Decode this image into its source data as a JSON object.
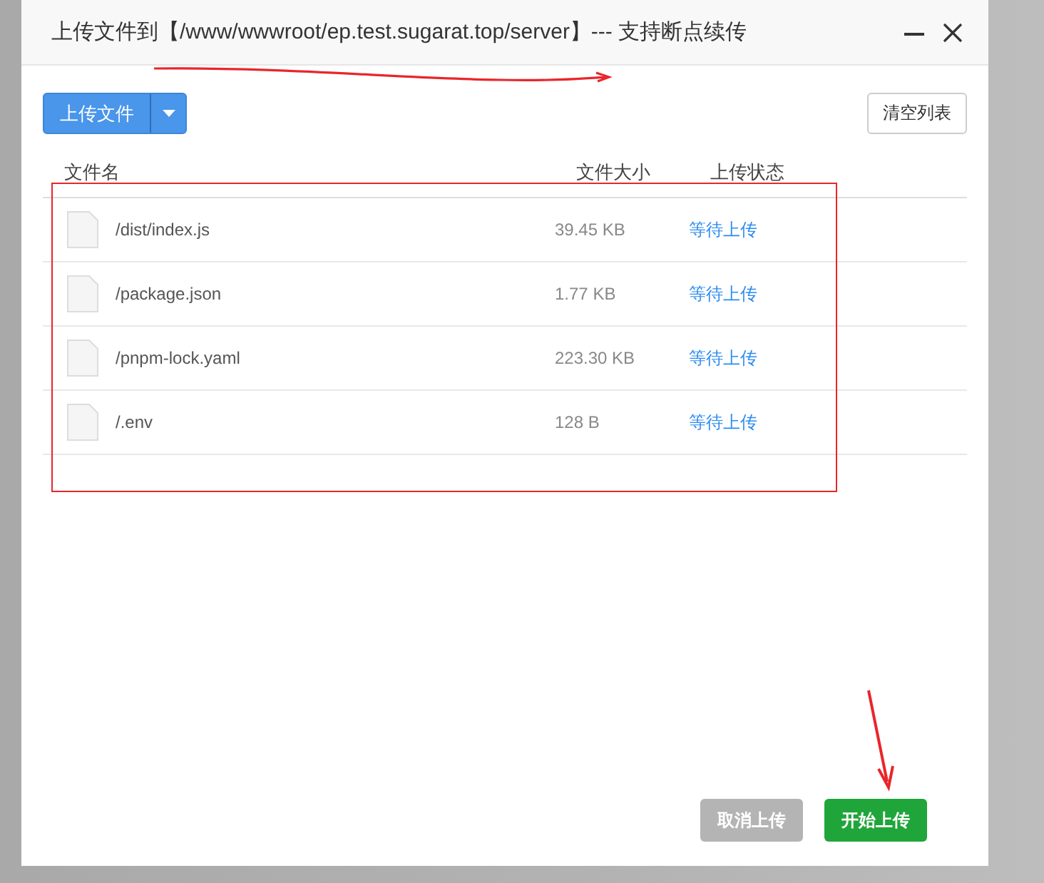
{
  "dialog": {
    "title": "上传文件到【/www/wwwroot/ep.test.sugarat.top/server】--- 支持断点续传"
  },
  "toolbar": {
    "upload_button": "上传文件",
    "clear_button": "清空列表"
  },
  "table": {
    "columns": [
      "文件名",
      "文件大小",
      "上传状态"
    ],
    "rows": [
      {
        "name": "/dist/index.js",
        "size": "39.45 KB",
        "status": "等待上传"
      },
      {
        "name": "/package.json",
        "size": "1.77 KB",
        "status": "等待上传"
      },
      {
        "name": "/pnpm-lock.yaml",
        "size": "223.30 KB",
        "status": "等待上传"
      },
      {
        "name": "/.env",
        "size": "128 B",
        "status": "等待上传"
      }
    ]
  },
  "footer_buttons": [
    {
      "label": "取消上传",
      "kind": "secondary",
      "disabled": true
    },
    {
      "label": "开始上传",
      "kind": "primary",
      "disabled": false
    }
  ]
}
